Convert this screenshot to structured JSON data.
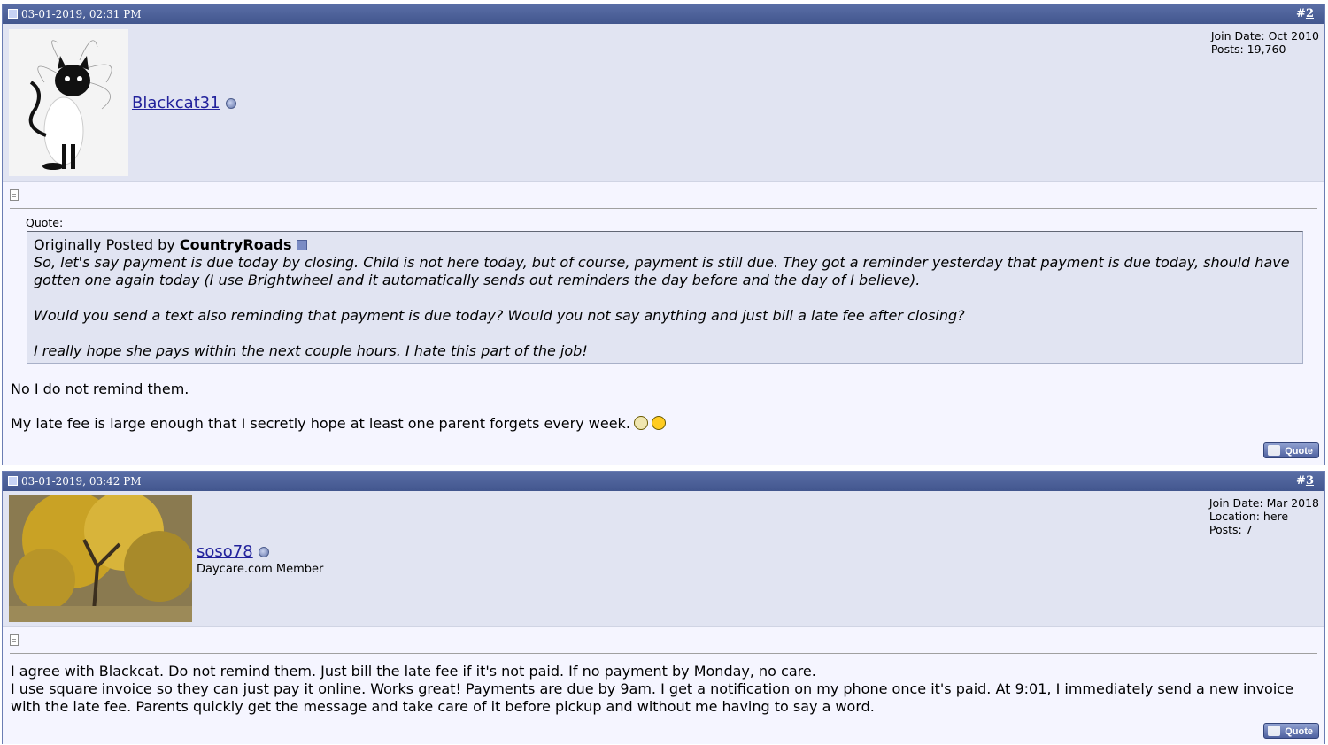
{
  "posts": [
    {
      "date": "03-01-2019, 02:31 PM",
      "number_prefix": "#",
      "number": "2",
      "username": "Blackcat31",
      "user_title": "",
      "stats": [
        "Join Date: Oct 2010",
        "Posts: 19,760"
      ],
      "quote_label": "Quote:",
      "quote_prefix": "Originally Posted by ",
      "quote_author": "CountryRoads",
      "quote_lines": [
        "So, let's say payment is due today by closing. Child is not here today, but of course, payment is still due. They got a reminder yesterday that payment is due today, should have gotten one again today (I use Brightwheel and it automatically sends out reminders the day before and the day of I believe).",
        "Would you send a text also reminding that payment is due today? Would you not say anything and just bill a late fee after closing?",
        "I really hope she pays within the next couple hours. I hate this part of the job!"
      ],
      "message": [
        "No I do not remind them.",
        "My late fee is large enough that I secretly hope at least one parent forgets every week."
      ],
      "smileys": [
        "laughing-smiley-icon",
        "wink-smiley-icon"
      ],
      "quote_button": "Quote"
    },
    {
      "date": "03-01-2019, 03:42 PM",
      "number_prefix": "#",
      "number": "3",
      "username": "soso78",
      "user_title": "Daycare.com Member",
      "stats": [
        "Join Date: Mar 2018",
        "Location: here",
        "Posts: 7"
      ],
      "message": [
        "I agree with Blackcat. Do not remind them. Just bill the late fee if it's not paid. If no payment by Monday, no care.",
        "I use square invoice so they can just pay it online. Works great! Payments are due by 9am. I get a notification on my phone once it's paid. At 9:01, I immediately send a new invoice with the late fee. Parents quickly get the message and take care of it before pickup and without me having to say a word."
      ],
      "quote_button": "Quote"
    }
  ],
  "colors": {
    "header": "#42568e",
    "userbar": "#e1e4f2",
    "body": "#f5f5ff",
    "username": "#22229c"
  }
}
